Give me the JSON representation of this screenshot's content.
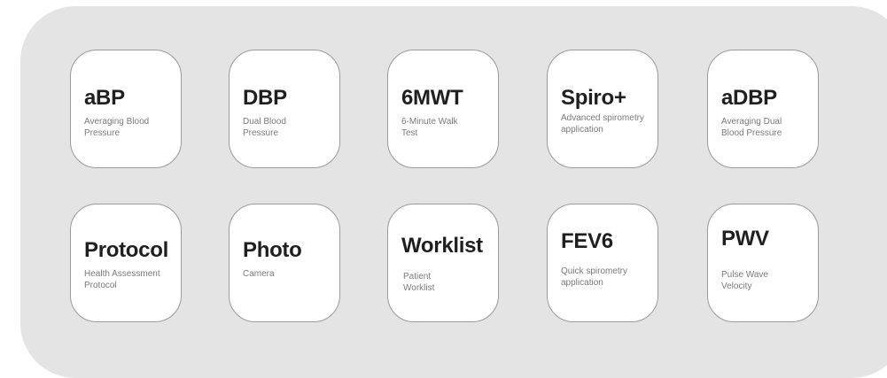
{
  "apps": [
    {
      "title": "aBP",
      "subtitle": "Averaging Blood\nPressure"
    },
    {
      "title": "DBP",
      "subtitle": "Dual Blood\nPressure"
    },
    {
      "title": "6MWT",
      "subtitle": "6-Minute Walk\nTest"
    },
    {
      "title": "Spiro+",
      "subtitle": "Advanced spirometry\napplication"
    },
    {
      "title": "aDBP",
      "subtitle": "Averaging Dual\nBlood Pressure"
    },
    {
      "title": "Protocol",
      "subtitle": "Health Assessment\nProtocol"
    },
    {
      "title": "Photo",
      "subtitle": "Camera"
    },
    {
      "title": "Worklist",
      "subtitle": "Patient\nWorklist"
    },
    {
      "title": "FEV6",
      "subtitle": "Quick spirometry\napplication"
    },
    {
      "title": "PWV",
      "subtitle": "Pulse Wave\nVelocity"
    }
  ]
}
